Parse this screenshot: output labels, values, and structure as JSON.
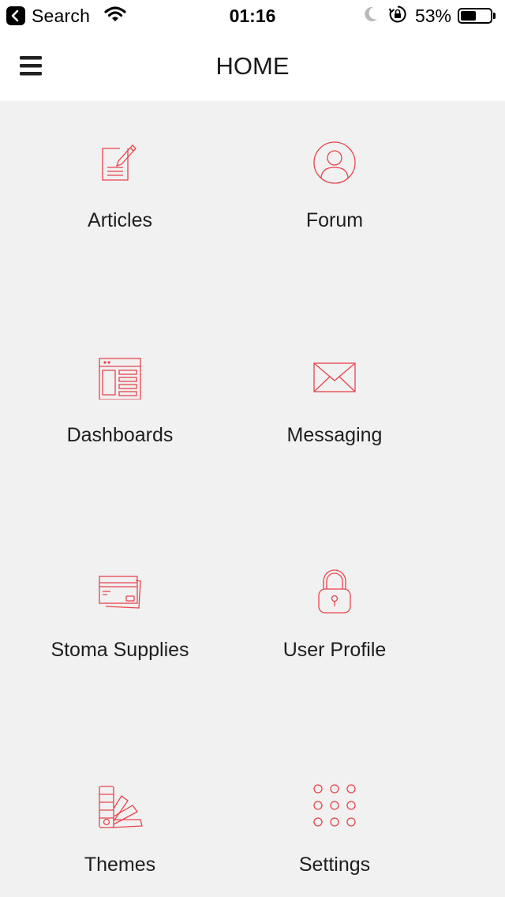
{
  "status_bar": {
    "back_app": "Search",
    "time": "01:16",
    "battery_percent": "53%",
    "battery_level": 0.53
  },
  "nav": {
    "title": "HOME",
    "menu_icon": "hamburger-menu-icon"
  },
  "accent_color": "#e8444c",
  "tiles": [
    {
      "label": "Articles",
      "icon": "article-edit-icon"
    },
    {
      "label": "Forum",
      "icon": "user-circle-icon"
    },
    {
      "label": "Dashboards",
      "icon": "dashboard-window-icon"
    },
    {
      "label": "Messaging",
      "icon": "envelope-icon"
    },
    {
      "label": "Stoma Supplies",
      "icon": "credit-card-icon"
    },
    {
      "label": "User Profile",
      "icon": "padlock-icon"
    },
    {
      "label": "Themes",
      "icon": "color-swatch-icon"
    },
    {
      "label": "Settings",
      "icon": "dots-grid-icon"
    }
  ]
}
